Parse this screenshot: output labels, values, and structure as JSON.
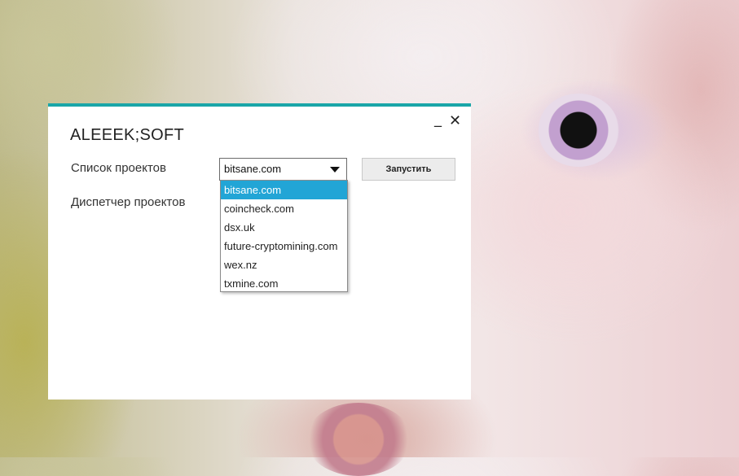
{
  "window": {
    "title": "ALEEEK;SOFT",
    "minimize_glyph": "_",
    "close_glyph": "✕",
    "accent_color": "#1aa6a8"
  },
  "form": {
    "projects_label": "Список проектов",
    "dispatcher_label": "Диспетчер проектов",
    "selected_project": "bitsane.com",
    "run_button_label": "Запустить"
  },
  "dropdown": {
    "selected_index": 0,
    "highlight_color": "#22a5d6",
    "options": [
      "bitsane.com",
      "coincheck.com",
      "dsx.uk",
      "future-cryptomining.com",
      "wex.nz",
      "txmine.com"
    ]
  }
}
